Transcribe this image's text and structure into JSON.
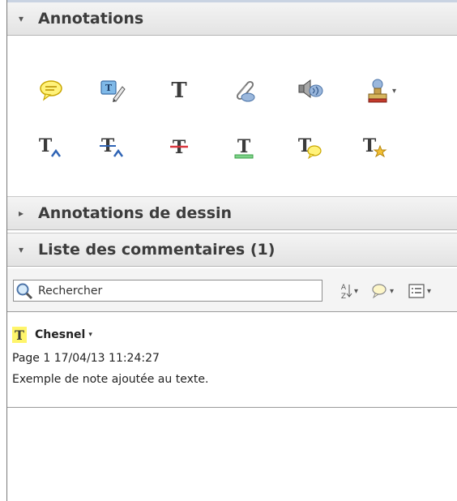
{
  "annotations_panel": {
    "title": "Annotations",
    "expanded_glyph": "▾",
    "tools_row1": [
      {
        "icon": "sticky-note-icon"
      },
      {
        "icon": "highlight-text-icon"
      },
      {
        "icon": "add-text-box-icon",
        "glyph": "T"
      },
      {
        "icon": "attach-file-icon"
      },
      {
        "icon": "record-audio-icon"
      },
      {
        "icon": "stamp-icon"
      }
    ],
    "tools_row2": [
      {
        "icon": "insert-text-icon",
        "glyph": "T"
      },
      {
        "icon": "replace-text-icon",
        "glyph": "T"
      },
      {
        "icon": "strikethrough-icon",
        "glyph": "T"
      },
      {
        "icon": "underline-icon",
        "glyph": "T"
      },
      {
        "icon": "add-note-to-text-icon",
        "glyph": "T"
      },
      {
        "icon": "text-favorite-icon",
        "glyph": "T"
      }
    ]
  },
  "drawing_panel": {
    "title": "Annotations de dessin",
    "collapsed_glyph": "▸"
  },
  "comments_list": {
    "title": "Liste des commentaires (1)",
    "expanded_glyph": "▾",
    "search": {
      "placeholder": "Rechercher",
      "value": ""
    },
    "toolbar": [
      {
        "icon": "sort-az-icon"
      },
      {
        "icon": "filter-comments-icon"
      },
      {
        "icon": "options-list-icon"
      }
    ],
    "comments": [
      {
        "type_glyph": "T",
        "author": "Chesnel",
        "page": "Page 1",
        "timestamp": "17/04/13 11:24:27",
        "text": "Exemple de note ajoutée au texte."
      }
    ]
  },
  "colors": {
    "header_bg": "#e3e3e3",
    "highlight_yellow": "#fff56b",
    "strike_red": "#d9363e",
    "underline_green": "#3aa046",
    "insert_blue": "#2f64b5"
  }
}
